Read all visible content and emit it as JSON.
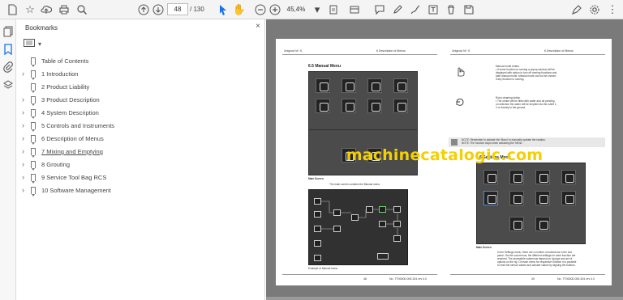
{
  "toolbar": {
    "page_current": "48",
    "page_total": "/ 130",
    "zoom": "45,4%"
  },
  "bookmarks_panel": {
    "title": "Bookmarks",
    "close": "×",
    "items": [
      {
        "label": "Table of Contents",
        "expandable": false,
        "underline": false
      },
      {
        "label": "1 Introduction",
        "expandable": true,
        "underline": false
      },
      {
        "label": "2 Product Liability",
        "expandable": false,
        "underline": false
      },
      {
        "label": "3 Product Description",
        "expandable": true,
        "underline": false
      },
      {
        "label": "4 System Description",
        "expandable": true,
        "underline": false
      },
      {
        "label": "5 Controls and Instruments",
        "expandable": true,
        "underline": false
      },
      {
        "label": "6 Description of Menus",
        "expandable": true,
        "underline": false
      },
      {
        "label": "7 Mixing and Emptying",
        "expandable": true,
        "underline": true
      },
      {
        "label": "8 Grouting",
        "expandable": true,
        "underline": false
      },
      {
        "label": "9 Service Tool Bag RCS",
        "expandable": true,
        "underline": false
      },
      {
        "label": "10 Software Management",
        "expandable": true,
        "underline": false
      }
    ]
  },
  "document": {
    "watermark": "machinecatalogic.com",
    "left_page": {
      "section": "6.5   Manual Menu",
      "main_screen_caption": "Main Screen",
      "body_text": "The main screen contains the Manual menu.",
      "example_caption": "Example of Manual menu."
    },
    "right_page": {
      "section": "6.6   Settings Menu",
      "main_screen_caption": "Main Screen"
    }
  },
  "colors": {
    "toolbar_bg": "#f4f4f4",
    "doc_bg": "#7a7a7a",
    "watermark": "#f5d000",
    "active_blue": "#1a73e8"
  }
}
